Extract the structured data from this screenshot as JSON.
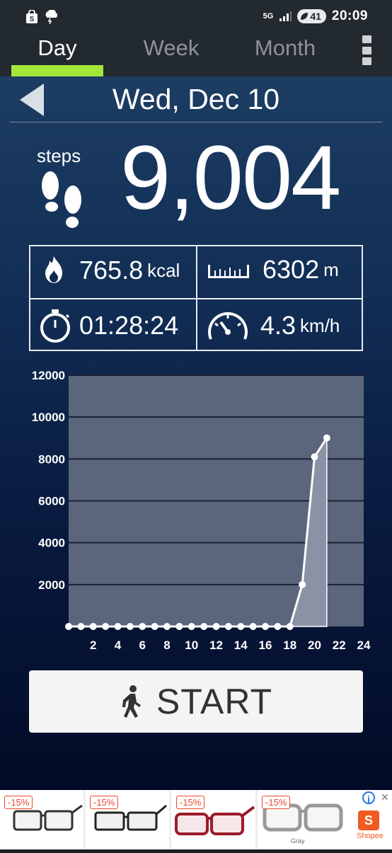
{
  "status_bar": {
    "time": "20:09",
    "network": "5G",
    "battery": "41",
    "icons": [
      "shopping-bag-icon",
      "weather-storm-icon",
      "signal-icon",
      "leaf-icon"
    ]
  },
  "tabs": [
    {
      "label": "Day",
      "active": true
    },
    {
      "label": "Week",
      "active": false
    },
    {
      "label": "Month",
      "active": false
    }
  ],
  "header": {
    "date": "Wed, Dec 10"
  },
  "steps": {
    "label": "steps",
    "value": "9,004"
  },
  "stats": {
    "calories": {
      "value": "765.8",
      "unit": "kcal"
    },
    "distance": {
      "value": "6302",
      "unit": "m"
    },
    "duration": {
      "value": "01:28:24",
      "unit": ""
    },
    "speed": {
      "value": "4.3",
      "unit": "km/h"
    }
  },
  "start_button": {
    "label": "START"
  },
  "ad": {
    "items": [
      {
        "badge": "-15%"
      },
      {
        "badge": "-15%"
      },
      {
        "badge": "-15%"
      },
      {
        "badge": "-15%"
      }
    ],
    "gray_label": "Gray",
    "brand": "Shopee"
  },
  "chart_data": {
    "type": "line",
    "x": [
      0,
      1,
      2,
      3,
      4,
      5,
      6,
      7,
      8,
      9,
      10,
      11,
      12,
      13,
      14,
      15,
      16,
      17,
      18,
      19,
      20,
      21
    ],
    "values": [
      0,
      0,
      0,
      0,
      0,
      0,
      0,
      0,
      0,
      0,
      0,
      0,
      0,
      0,
      0,
      0,
      0,
      0,
      0,
      2000,
      8100,
      9004
    ],
    "x_ticks": [
      "2",
      "4",
      "6",
      "8",
      "10",
      "12",
      "14",
      "16",
      "18",
      "20",
      "22",
      "24"
    ],
    "y_ticks": [
      "2000",
      "4000",
      "6000",
      "8000",
      "10000",
      "12000"
    ],
    "xlim": [
      0,
      24
    ],
    "ylim": [
      0,
      12000
    ],
    "grid": true,
    "title": "",
    "xlabel": "",
    "ylabel": "",
    "colors": {
      "plot_bg": "#5b667d",
      "line": "#ffffff",
      "fill": "#8a93a6",
      "grid": "#1a2135"
    }
  }
}
